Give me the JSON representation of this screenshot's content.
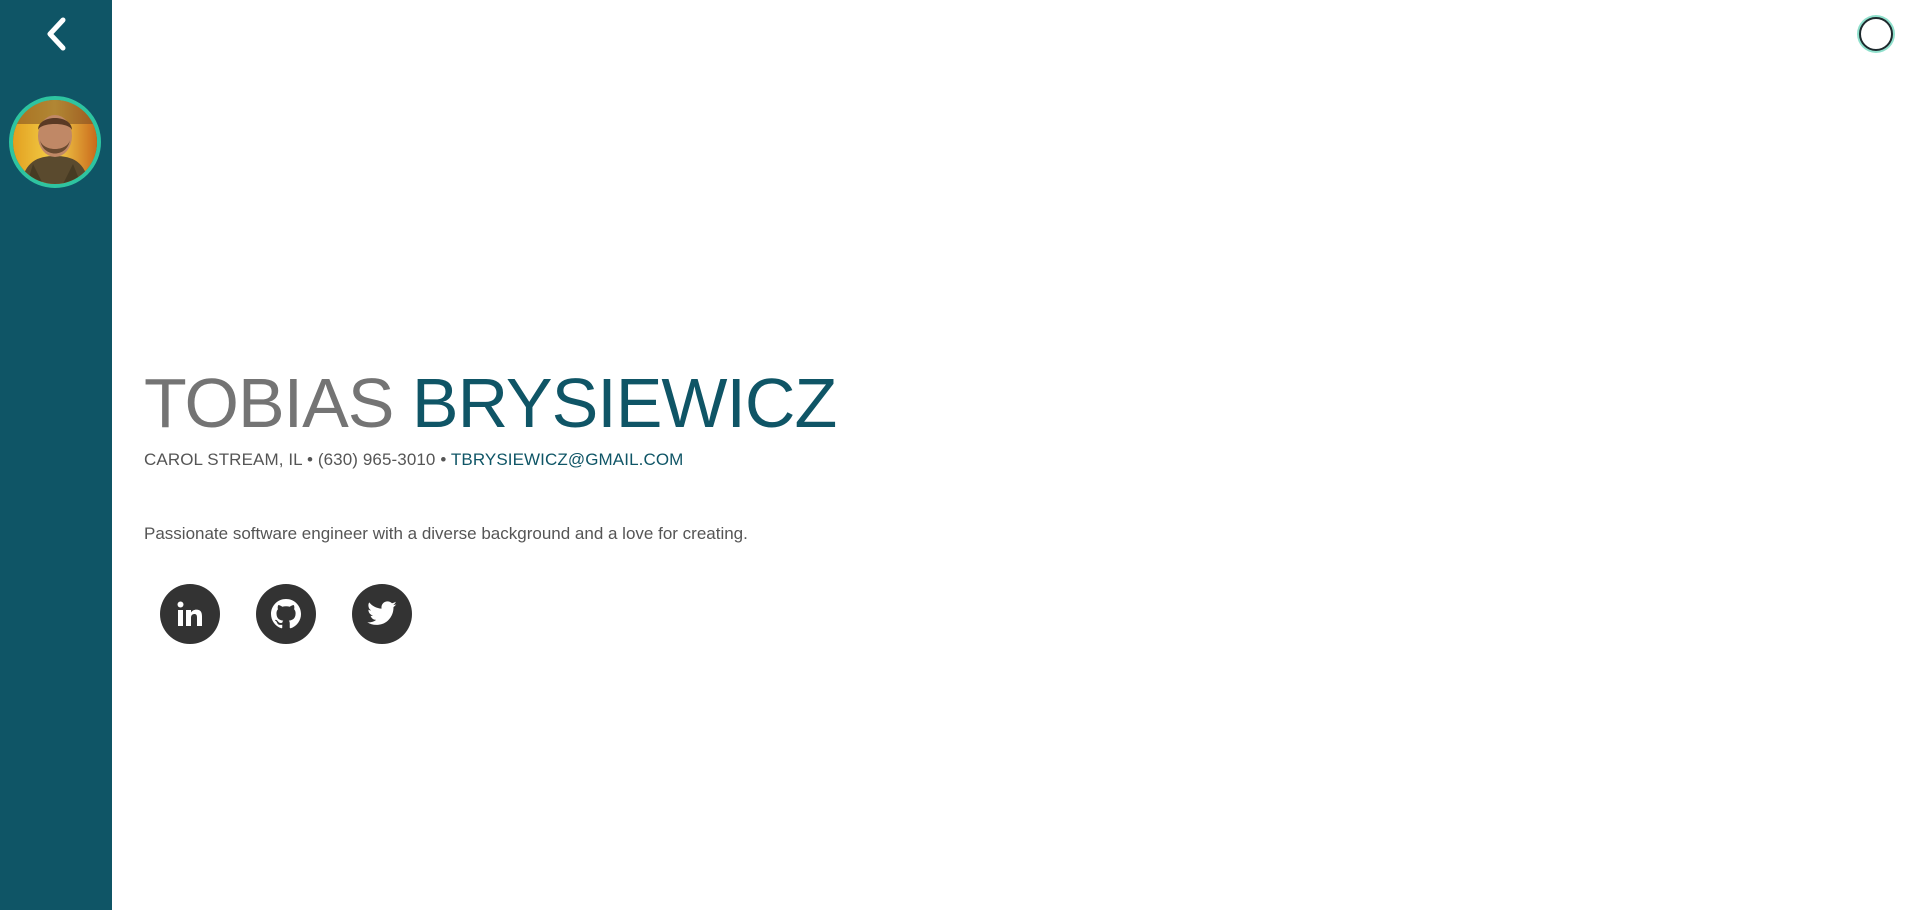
{
  "sidebar": {
    "back_icon": "chevron-left-icon",
    "avatar_icon": "profile-photo",
    "accent_color": "#0f5566",
    "avatar_ring_color": "#2ec4a0"
  },
  "header": {
    "theme_toggle_icon": "circle-toggle-icon"
  },
  "profile": {
    "first_name": "TOBIAS",
    "last_name": "BRYSIEWICZ",
    "location": "CAROL STREAM, IL",
    "separator": "•",
    "phone": "(630) 965-3010",
    "email": "TBRYSIEWICZ@GMAIL.COM",
    "tagline": "Passionate software engineer with a diverse background and a love for creating."
  },
  "socials": [
    {
      "icon": "linkedin-icon"
    },
    {
      "icon": "github-icon"
    },
    {
      "icon": "twitter-icon"
    }
  ]
}
